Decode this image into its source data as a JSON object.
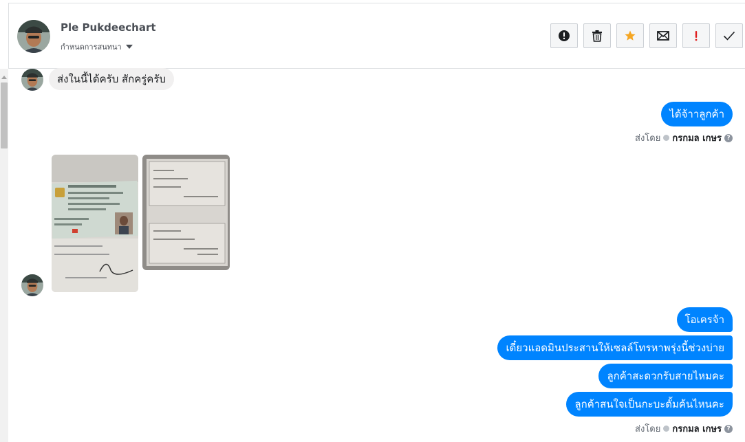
{
  "header": {
    "contact_name": "Ple Pukdeechart",
    "label_select": "กำหนดการสนทนา"
  },
  "toolbar": {
    "buttons": [
      {
        "name": "spam",
        "icon": "exclamation-circle-icon"
      },
      {
        "name": "delete",
        "icon": "trash-icon"
      },
      {
        "name": "star",
        "icon": "star-icon",
        "color": "#f5a623"
      },
      {
        "name": "unread",
        "icon": "envelope-icon"
      },
      {
        "name": "important",
        "icon": "exclamation-icon",
        "color": "#e02020"
      },
      {
        "name": "done",
        "icon": "check-icon"
      }
    ]
  },
  "messages": {
    "in_1": "ส่งในนี้ได้ครับ สักครู่ครับ",
    "out_1": "ได้จ้าาลูกค้า",
    "sent_by_1": {
      "prefix": "ส่งโดย",
      "agent": "กรกมล เกษร"
    },
    "attachments": [
      {
        "icon": "id-card-photo"
      },
      {
        "icon": "document-photo"
      }
    ],
    "out_2": "โอเครจ้า",
    "out_3": "เดี๋ยวแอดมินประสานให้เซลล์โทรหาพรุ่งนี้ช่วงบ่าย",
    "out_4": "ลูกค้าสะดวกรับสายไหมคะ",
    "out_5": "ลูกค้าสนใจเป็นกะบะดั้มค้นไหนคะ",
    "sent_by_2": {
      "prefix": "ส่งโดย",
      "agent": "กรกมล เกษร"
    }
  },
  "colors": {
    "accent": "#0084ff",
    "incoming_bubble": "#f1f0f0"
  }
}
